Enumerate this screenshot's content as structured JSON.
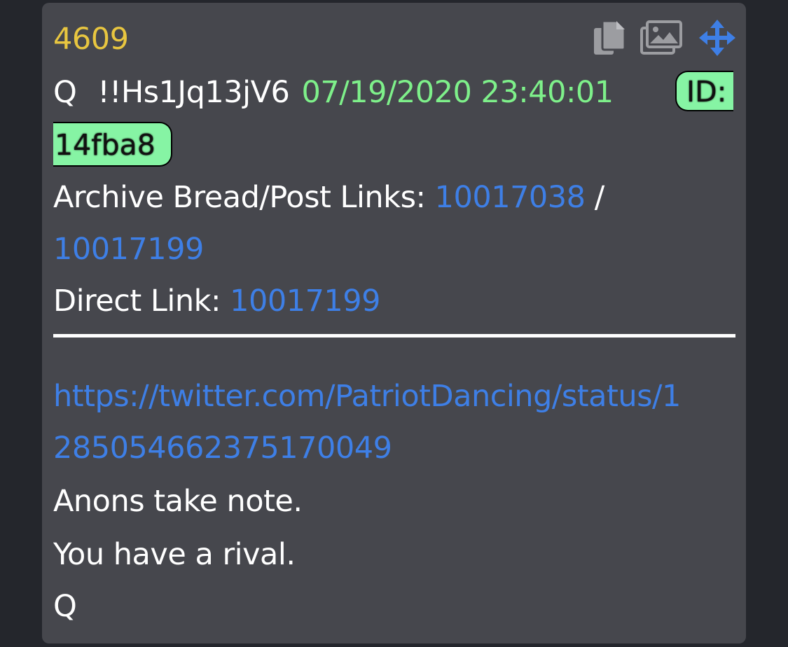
{
  "post": {
    "number": "4609",
    "author": "Q",
    "tripcode": "!!Hs1Jq13jV6",
    "datetime": "07/19/2020 23:40:01",
    "id_part1": "ID:",
    "id_part2": "14fba8",
    "archive_label": "Archive Bread/Post Links:",
    "archive_link1": "10017038",
    "archive_separator": "/",
    "archive_link2": "10017199",
    "direct_label": "Direct Link:",
    "direct_link": "10017199",
    "url_line1": "https://twitter.com/PatriotDancing/status/1",
    "url_line2": "285054662375170049",
    "message": [
      "Anons take note.",
      "You have a rival.",
      "Q"
    ]
  },
  "toolbar": {
    "icons": [
      "copy-icon",
      "images-icon",
      "move-icon"
    ]
  },
  "colors": {
    "background": "#24262c",
    "card": "#46474d",
    "post_number": "#e8c640",
    "date": "#7ef08a",
    "link": "#3e7fe6",
    "id_badge": "#86f4a4",
    "icon_gray": "#9c9da1",
    "move_icon": "#3e7fe6"
  }
}
